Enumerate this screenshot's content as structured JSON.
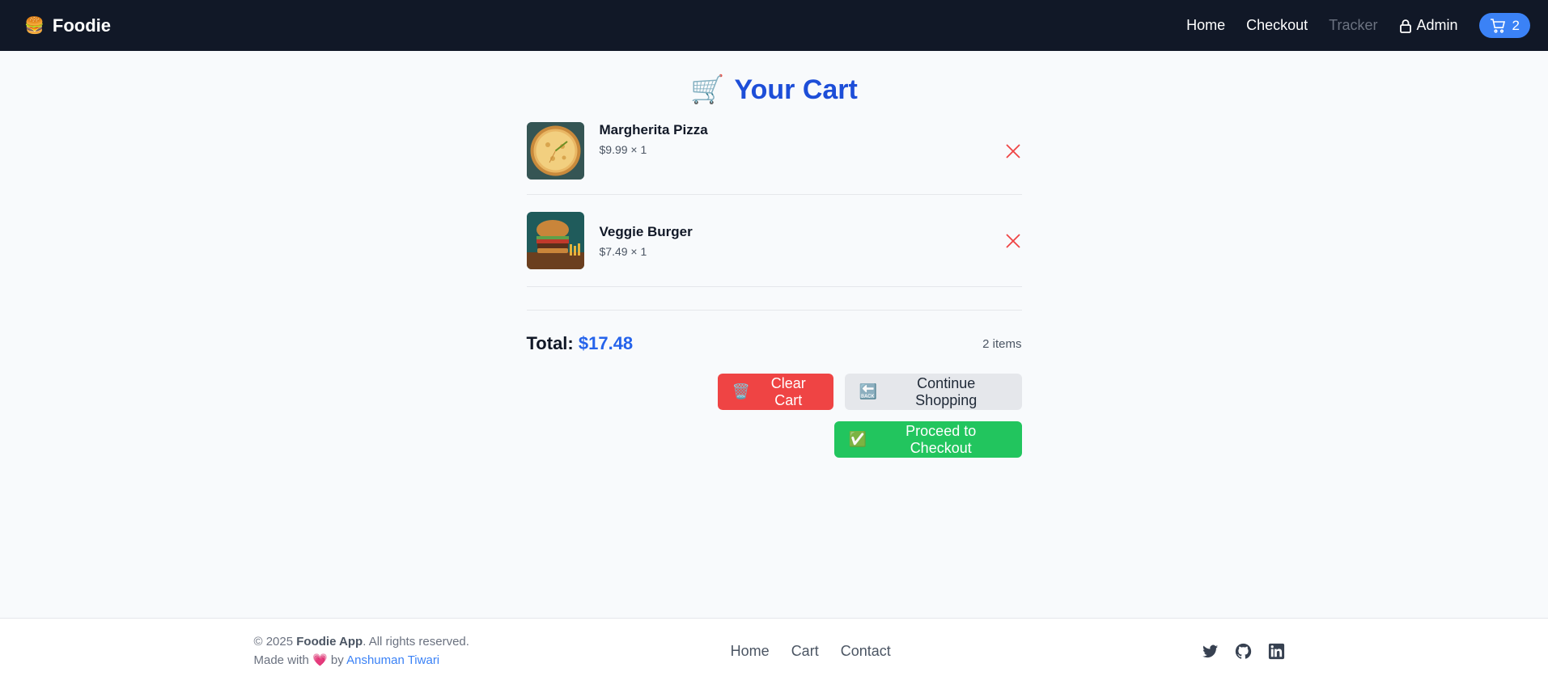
{
  "nav": {
    "brand": "Foodie",
    "logo_icon": "🍔",
    "links": [
      "Home",
      "Checkout",
      "Tracker"
    ],
    "admin": "Admin",
    "cart_count": "2"
  },
  "page": {
    "title": "Your Cart",
    "title_icon": "🛒"
  },
  "cart": {
    "items": [
      {
        "name": "Margherita Pizza",
        "price": "$9.99 × 1",
        "image": "pizza"
      },
      {
        "name": "Veggie Burger",
        "price": "$7.49 × 1",
        "image": "burger"
      }
    ],
    "total_label": "Total:",
    "total_value": "$17.48",
    "count": "2 items"
  },
  "actions": {
    "clear": "Clear Cart",
    "clear_icon": "🗑️",
    "continue": "Continue Shopping",
    "continue_icon": "🔙",
    "checkout": "Proceed to Checkout",
    "checkout_icon": "✅"
  },
  "footer": {
    "copy_prefix": "© 2025",
    "app_name": "Foodie App",
    "copy_suffix": ". All rights reserved.",
    "made_with": "Made with",
    "heart": "💗",
    "by": "by",
    "author": "Anshuman Tiwari",
    "links": [
      "Home",
      "Cart",
      "Contact"
    ],
    "social": [
      "twitter-icon",
      "github-icon",
      "linkedin-icon"
    ]
  },
  "colors": {
    "navbar": "#111827",
    "accent": "#2563eb",
    "danger": "#ef4444",
    "success": "#22c55e"
  }
}
